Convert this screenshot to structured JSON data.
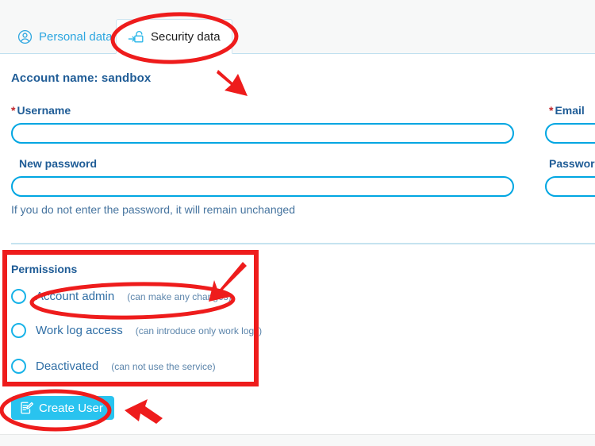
{
  "tabs": [
    {
      "label": "Personal data",
      "icon": "user-circle-icon",
      "active": false
    },
    {
      "label": "Security data",
      "icon": "lock-login-icon",
      "active": true
    }
  ],
  "account": {
    "name_label": "Account name: sandbox"
  },
  "form": {
    "username": {
      "label": "Username",
      "required_marker": "*",
      "value": "",
      "placeholder": ""
    },
    "email": {
      "label": "Email",
      "required_marker": "*",
      "value": "",
      "placeholder": ""
    },
    "new_password": {
      "label": "New password",
      "required_marker": "",
      "value": "",
      "placeholder": ""
    },
    "password_repeat": {
      "label": "Password repeat",
      "required_marker": "",
      "value": "",
      "placeholder": ""
    },
    "hint": "If you do not enter the password, it will remain unchanged"
  },
  "permissions": {
    "title": "Permissions",
    "options": [
      {
        "name": "Account admin",
        "note": "(can make any changes)",
        "selected": false
      },
      {
        "name": "Work log access",
        "note": "(can introduce only work logs)",
        "selected": false
      },
      {
        "name": "Deactivated",
        "note": "(can not use the service)",
        "selected": false
      }
    ]
  },
  "actions": {
    "create_user": {
      "label": "Create User",
      "icon": "document-edit-icon"
    }
  },
  "colors": {
    "accent_cyan": "#00a6e2",
    "button_cyan": "#29c3ef",
    "label_blue": "#1f5c96",
    "tab_blue": "#2ca6e0",
    "required_red": "#c1272d",
    "annotation_red": "#ee1c1c",
    "divider_blue": "#c5e3f0",
    "page_bg": "#ffffff",
    "strip_bg": "#f7f8f8"
  },
  "annotations": [
    {
      "kind": "ellipse",
      "target": "security-data-tab"
    },
    {
      "kind": "arrow",
      "target": "security-data-tab"
    },
    {
      "kind": "rectangle",
      "target": "permissions-panel"
    },
    {
      "kind": "arrow",
      "target": "permissions-panel"
    },
    {
      "kind": "ellipse",
      "target": "account-admin-option"
    },
    {
      "kind": "ellipse",
      "target": "create-user-button"
    },
    {
      "kind": "arrow",
      "target": "create-user-button"
    }
  ]
}
